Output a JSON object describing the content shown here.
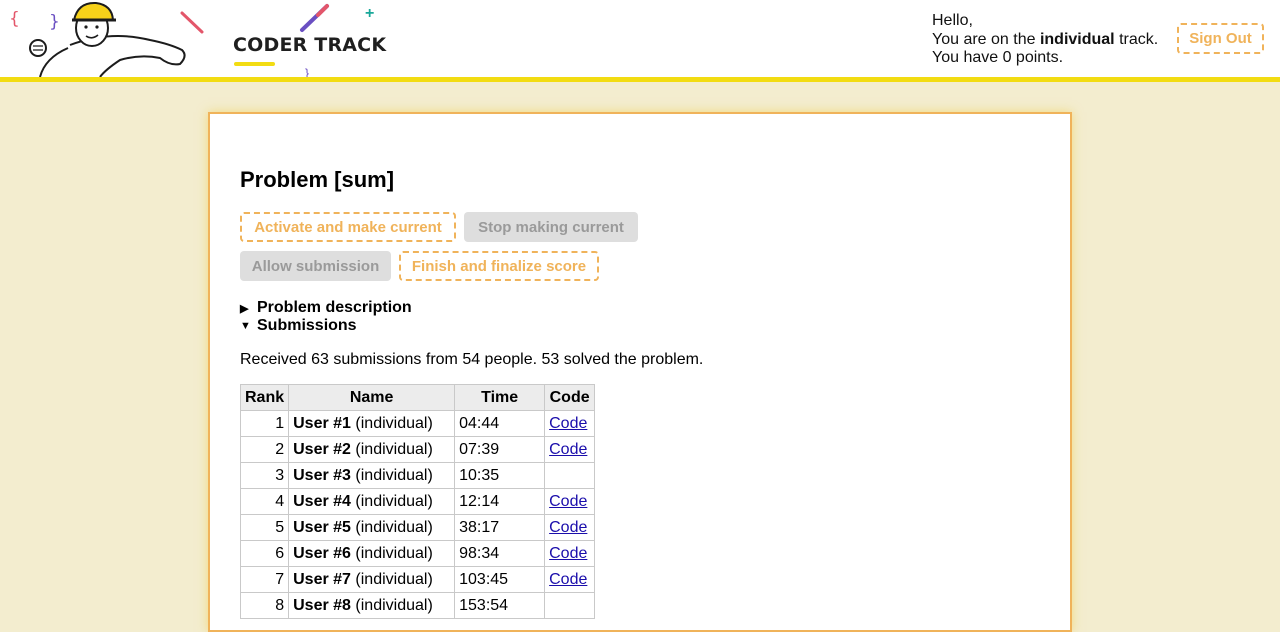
{
  "brand": {
    "logo_text": "CODER TRACK",
    "mascot_icon": "cartoon-coder-with-hardhat",
    "accent_color": "#f2dc12",
    "button_color": "#f0b35a"
  },
  "header": {
    "greeting_hello": "Hello,",
    "track_prefix": "You are on the ",
    "track_name": "individual",
    "track_suffix": " track.",
    "points_text": "You have 0 points.",
    "signout_label": "Sign Out"
  },
  "problem": {
    "title": "Problem [sum]",
    "buttons": {
      "activate": "Activate and make current",
      "stop": "Stop making current",
      "allow": "Allow submission",
      "finish": "Finish and finalize score"
    },
    "description_toggle": "Problem description",
    "description_state": "collapsed",
    "submissions_toggle": "Submissions",
    "submissions_state": "expanded",
    "summary": "Received 63 submissions from 54 people. 53 solved the problem.",
    "table": {
      "headers": [
        "Rank",
        "Name",
        "Time",
        "Code"
      ],
      "rows": [
        {
          "rank": "1",
          "name": "User #1",
          "track": "(individual)",
          "time": "04:44",
          "code": "Code"
        },
        {
          "rank": "2",
          "name": "User #2",
          "track": "(individual)",
          "time": "07:39",
          "code": "Code"
        },
        {
          "rank": "3",
          "name": "User #3",
          "track": "(individual)",
          "time": "10:35",
          "code": ""
        },
        {
          "rank": "4",
          "name": "User #4",
          "track": "(individual)",
          "time": "12:14",
          "code": "Code"
        },
        {
          "rank": "5",
          "name": "User #5",
          "track": "(individual)",
          "time": "38:17",
          "code": "Code"
        },
        {
          "rank": "6",
          "name": "User #6",
          "track": "(individual)",
          "time": "98:34",
          "code": "Code"
        },
        {
          "rank": "7",
          "name": "User #7",
          "track": "(individual)",
          "time": "103:45",
          "code": "Code"
        },
        {
          "rank": "8",
          "name": "User #8",
          "track": "(individual)",
          "time": "153:54",
          "code": ""
        }
      ]
    }
  }
}
